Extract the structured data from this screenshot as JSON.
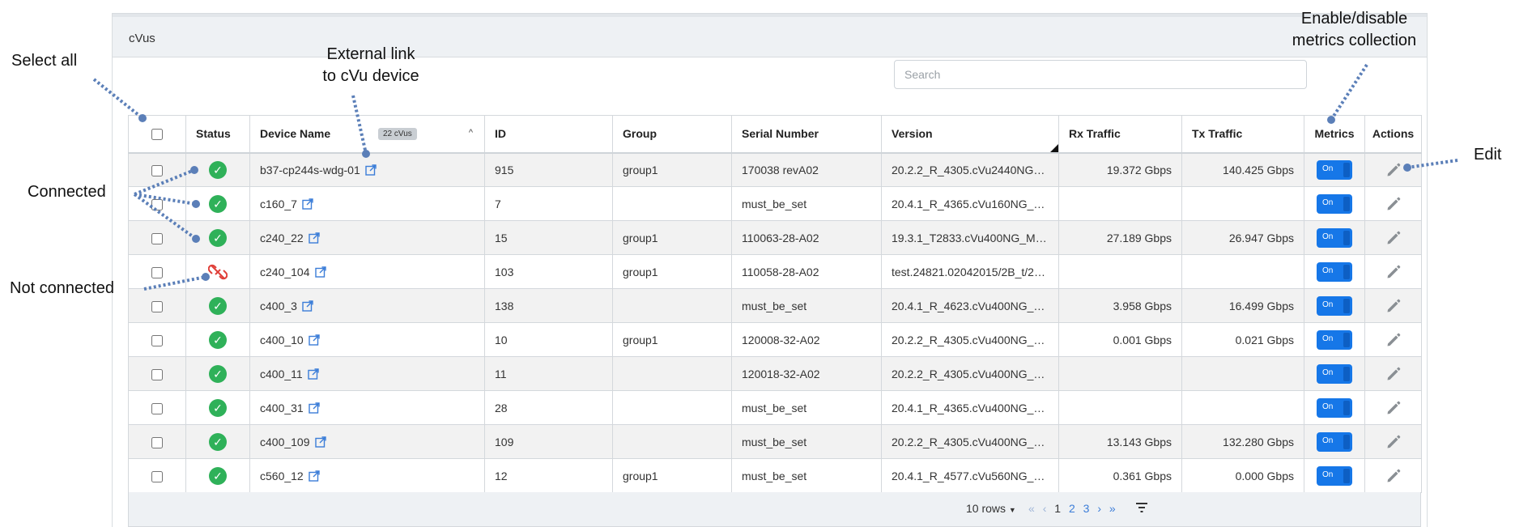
{
  "panel": {
    "title": "cVus"
  },
  "search": {
    "placeholder": "Search"
  },
  "table": {
    "columns": {
      "status": "Status",
      "device_name": "Device Name",
      "device_count_badge": "22 cVus",
      "id": "ID",
      "group": "Group",
      "serial_number": "Serial Number",
      "version": "Version",
      "rx_traffic": "Rx Traffic",
      "tx_traffic": "Tx Traffic",
      "metrics": "Metrics",
      "actions": "Actions"
    },
    "status_icons": {
      "connected": "check-circle-icon",
      "not_connected": "broken-link-icon"
    },
    "link_icon": "external-link-icon",
    "edit_icon": "pencil-icon",
    "toggle_label": "On",
    "colors": {
      "connected": "#2fb159",
      "not_connected": "#e0403a",
      "accent": "#1677e8",
      "link": "#3b7dd8"
    },
    "rows": [
      {
        "status": "connected",
        "name": "b37-cp244s-wdg-01",
        "id": "915",
        "group": "group1",
        "serial": "170038 revA02",
        "version": "20.2.2_R_4305.cVu2440NG_MAS...",
        "rx": "19.372 Gbps",
        "tx": "140.425 Gbps",
        "metrics": "On"
      },
      {
        "status": "connected",
        "name": "c160_7",
        "id": "7",
        "group": "",
        "serial": "must_be_set",
        "version": "20.4.1_R_4365.cVu160NG_MAST...",
        "rx": "",
        "tx": "",
        "metrics": "On"
      },
      {
        "status": "connected",
        "name": "c240_22",
        "id": "15",
        "group": "group1",
        "serial": "110063-28-A02",
        "version": "19.3.1_T2833.cVu400NG_MAST...",
        "rx": "27.189 Gbps",
        "tx": "26.947 Gbps",
        "metrics": "On"
      },
      {
        "status": "not_connected",
        "name": "c240_104",
        "id": "103",
        "group": "group1",
        "serial": "110058-28-A02",
        "version": "test.24821.02042015/2B_t/2B/2B",
        "rx": "",
        "tx": "",
        "metrics": "On"
      },
      {
        "status": "connected",
        "name": "c400_3",
        "id": "138",
        "group": "",
        "serial": "must_be_set",
        "version": "20.4.1_R_4623.cVu400NG_MAS...",
        "rx": "3.958 Gbps",
        "tx": "16.499 Gbps",
        "metrics": "On"
      },
      {
        "status": "connected",
        "name": "c400_10",
        "id": "10",
        "group": "group1",
        "serial": "120008-32-A02",
        "version": "20.2.2_R_4305.cVu400NG_MAS...",
        "rx": "0.001 Gbps",
        "tx": "0.021 Gbps",
        "metrics": "On"
      },
      {
        "status": "connected",
        "name": "c400_11",
        "id": "11",
        "group": "",
        "serial": "120018-32-A02",
        "version": "20.2.2_R_4305.cVu400NG_MAS...",
        "rx": "",
        "tx": "",
        "metrics": "On"
      },
      {
        "status": "connected",
        "name": "c400_31",
        "id": "28",
        "group": "",
        "serial": "must_be_set",
        "version": "20.4.1_R_4365.cVu400NG_MAS...",
        "rx": "",
        "tx": "",
        "metrics": "On"
      },
      {
        "status": "connected",
        "name": "c400_109",
        "id": "109",
        "group": "",
        "serial": "must_be_set",
        "version": "20.2.2_R_4305.cVu400NG_MAS...",
        "rx": "13.143 Gbps",
        "tx": "132.280 Gbps",
        "metrics": "On"
      },
      {
        "status": "connected",
        "name": "c560_12",
        "id": "12",
        "group": "group1",
        "serial": "must_be_set",
        "version": "20.4.1_R_4577.cVu560NG_MAS...",
        "rx": "0.361 Gbps",
        "tx": "0.000 Gbps",
        "metrics": "On"
      }
    ]
  },
  "footer": {
    "rows_per_page": "10 rows",
    "pager": {
      "first": "«",
      "prev": "‹",
      "pages": [
        "1",
        "2",
        "3"
      ],
      "current": "1",
      "next": "›",
      "last": "»"
    }
  },
  "annotations": {
    "select_all": "Select all",
    "external_link_line1": "External link",
    "external_link_line2": "to cVu device",
    "connected": "Connected",
    "not_connected": "Not connected",
    "metrics_line1": "Enable/disable",
    "metrics_line2": "metrics collection",
    "edit": "Edit"
  }
}
